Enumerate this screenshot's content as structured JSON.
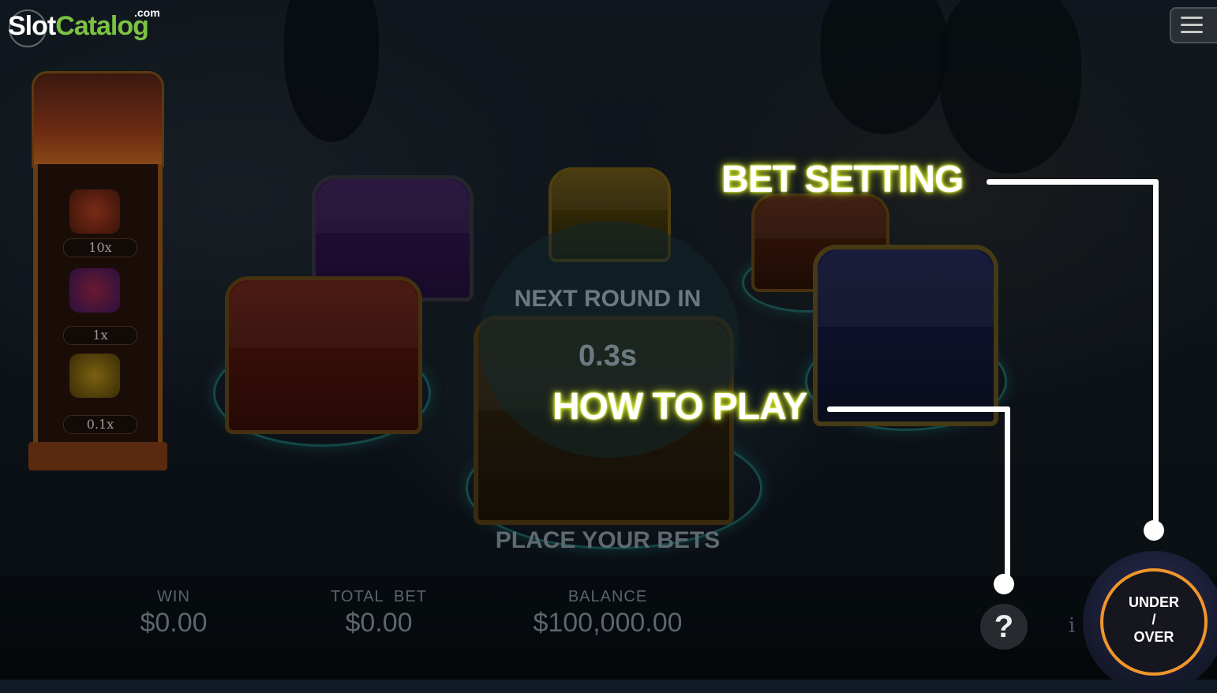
{
  "branding": {
    "logo_slot": "Slot",
    "logo_catalog": "Catalog",
    "logo_com": ".com"
  },
  "menu": {
    "icon": "hamburger-menu-icon"
  },
  "paytable": {
    "items": [
      {
        "icon": "crown-icon",
        "multiplier": "10x"
      },
      {
        "icon": "gems-icon",
        "multiplier": "1x"
      },
      {
        "icon": "gold-coins-icon",
        "multiplier": "0.1x"
      }
    ]
  },
  "round": {
    "next_round_label": "NEXT ROUND IN",
    "countdown": "0.3s",
    "place_bets": "PLACE YOUR BETS"
  },
  "callouts": {
    "bet_setting": "BET SETTING",
    "how_to_play": "HOW TO PLAY"
  },
  "stats": {
    "win_label": "WIN",
    "win_value": "$0.00",
    "total_bet_label": "TOTAL  BET",
    "total_bet_value": "$0.00",
    "balance_label": "BALANCE",
    "balance_value": "$100,000.00"
  },
  "controls": {
    "help": "?",
    "info": "i",
    "under": "UNDER",
    "slash": "/",
    "over": "OVER"
  },
  "colors": {
    "accent_orange": "#f0962c",
    "callout_glow": "#e8ff3a",
    "logo_green": "#7cc242",
    "ring_teal": "#28b4aa"
  }
}
